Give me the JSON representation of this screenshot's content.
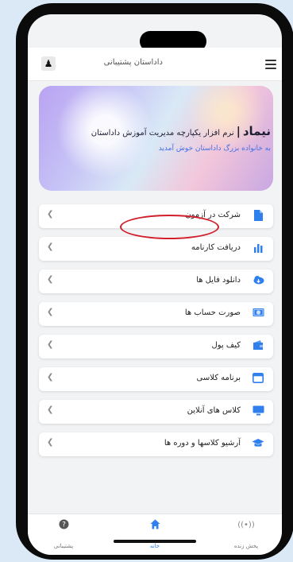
{
  "topbar": {
    "support_text": "داداستان پشتیبانی",
    "menu_icon": "hamburger-menu-icon",
    "user_icon": "user-icon"
  },
  "banner": {
    "brand": "نیماد",
    "separator": "|",
    "tagline": "نرم افزار یکپارچه مدیریت آموزش داداستان",
    "welcome": "به خانواده بزرگ داداستان خوش آمدید"
  },
  "menu": [
    {
      "label": "شرکت در آزمون",
      "icon": "document-icon",
      "icon_color": "#2f80ed"
    },
    {
      "label": "دریافت کارنامه",
      "icon": "bar-chart-icon",
      "icon_color": "#2f80ed"
    },
    {
      "label": "دانلود فایل ها",
      "icon": "cloud-download-icon",
      "icon_color": "#2f80ed"
    },
    {
      "label": "صورت حساب ها",
      "icon": "bill-icon",
      "icon_color": "#2f80ed"
    },
    {
      "label": "کیف پول",
      "icon": "wallet-icon",
      "icon_color": "#2f80ed"
    },
    {
      "label": "برنامه کلاسی",
      "icon": "calendar-icon",
      "icon_color": "#2f80ed"
    },
    {
      "label": "کلاس های آنلاین",
      "icon": "monitor-icon",
      "icon_color": "#2f80ed"
    },
    {
      "label": "آرشیو کلاسها و دوره ها",
      "icon": "graduation-cap-icon",
      "icon_color": "#2f80ed"
    }
  ],
  "bottom_nav": {
    "support_label": "پشتیبانی",
    "home_label": "خانه",
    "live_label": "پخش زنده"
  },
  "colors": {
    "accent": "#2f80ed",
    "highlight": "#d21e2b"
  }
}
